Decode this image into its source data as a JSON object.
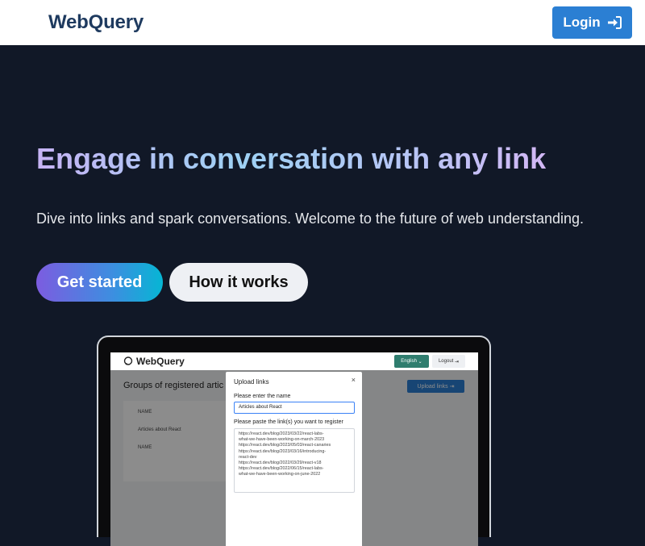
{
  "header": {
    "brand": "WebQuery",
    "login_label": "Login"
  },
  "hero": {
    "headline": "Engage in conversation with any link",
    "subline": "Dive into links and spark conversations. Welcome to the future of web understanding.",
    "primary_cta": "Get started",
    "secondary_cta": "How it works"
  },
  "preview": {
    "brand": "WebQuery",
    "language": "English",
    "logout": "Logout",
    "page_title": "Groups of registered artic",
    "upload_button": "Upload links",
    "table": [
      "NAME",
      "Articles about React",
      "NAME"
    ],
    "modal": {
      "title": "Upload links",
      "close": "×",
      "name_label": "Please enter the name",
      "name_value": "Articles about React",
      "links_label": "Please paste the link(s) you want to register",
      "links": [
        "https://react.dev/blog/2023/03/22/react-labs-",
        "what-we-have-been-working-on-march-2023",
        "https://react.dev/blog/2023/05/03/react-canaries",
        "https://react.dev/blog/2023/03/16/introducing-",
        "react-dev",
        "https://react.dev/blog/2022/03/29/react-v18",
        "https://react.dev/blog/2022/06/15/react-labs-",
        "what-we-have-been-working-on-june-2022"
      ]
    }
  },
  "colors": {
    "hero_bg": "#111827",
    "login_bg": "#2b7fd3",
    "brand": "#1e3a5f"
  }
}
